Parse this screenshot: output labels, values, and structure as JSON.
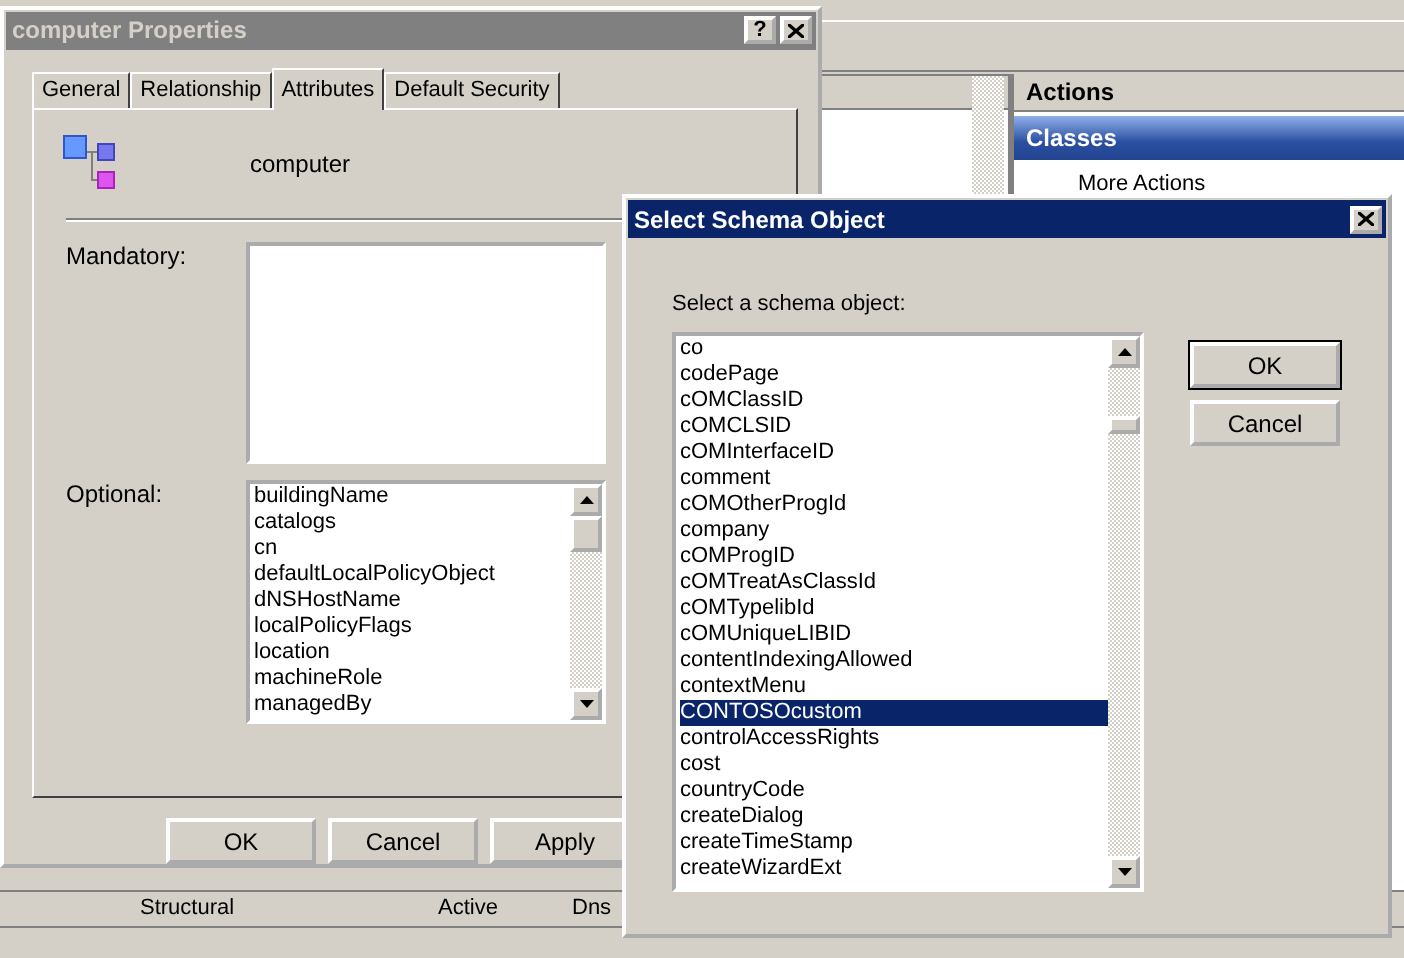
{
  "console": {
    "actions_header": "Actions",
    "classes_header": "Classes",
    "more_actions": "More Actions",
    "bottom_row": [
      "Structural",
      "Active",
      "Dns"
    ]
  },
  "properties": {
    "title": "computer Properties",
    "help_glyph": "?",
    "tabs": [
      {
        "label": "General",
        "selected": false
      },
      {
        "label": "Relationship",
        "selected": false
      },
      {
        "label": "Attributes",
        "selected": true
      },
      {
        "label": "Default Security",
        "selected": false
      }
    ],
    "class_name": "computer",
    "mandatory_label": "Mandatory:",
    "optional_label": "Optional:",
    "optional_items": [
      "buildingName",
      "catalogs",
      "cn",
      "defaultLocalPolicyObject",
      "dNSHostName",
      "localPolicyFlags",
      "location",
      "machineRole",
      "managedBy"
    ],
    "buttons": [
      "OK",
      "Cancel",
      "Apply"
    ]
  },
  "schema_dialog": {
    "title": "Select Schema Object",
    "prompt": "Select a schema object:",
    "items": [
      {
        "name": "co",
        "selected": false
      },
      {
        "name": "codePage",
        "selected": false
      },
      {
        "name": "cOMClassID",
        "selected": false
      },
      {
        "name": "cOMCLSID",
        "selected": false
      },
      {
        "name": "cOMInterfaceID",
        "selected": false
      },
      {
        "name": "comment",
        "selected": false
      },
      {
        "name": "cOMOtherProgId",
        "selected": false
      },
      {
        "name": "company",
        "selected": false
      },
      {
        "name": "cOMProgID",
        "selected": false
      },
      {
        "name": "cOMTreatAsClassId",
        "selected": false
      },
      {
        "name": "cOMTypelibId",
        "selected": false
      },
      {
        "name": "cOMUniqueLIBID",
        "selected": false
      },
      {
        "name": "contentIndexingAllowed",
        "selected": false
      },
      {
        "name": "contextMenu",
        "selected": false
      },
      {
        "name": "CONTOSOcustom",
        "selected": true
      },
      {
        "name": "controlAccessRights",
        "selected": false
      },
      {
        "name": "cost",
        "selected": false
      },
      {
        "name": "countryCode",
        "selected": false
      },
      {
        "name": "createDialog",
        "selected": false
      },
      {
        "name": "createTimeStamp",
        "selected": false
      },
      {
        "name": "createWizardExt",
        "selected": false
      }
    ],
    "buttons": [
      {
        "label": "OK",
        "default": true
      },
      {
        "label": "Cancel",
        "default": false
      }
    ]
  }
}
